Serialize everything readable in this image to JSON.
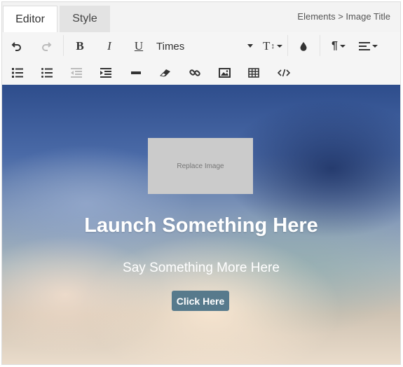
{
  "tabs": [
    {
      "label": "Editor",
      "active": true
    },
    {
      "label": "Style",
      "active": false
    }
  ],
  "breadcrumb": "Elements > Image Title",
  "toolbar": {
    "font_family": "Times",
    "bold_label": "B",
    "italic_label": "I",
    "underline_label": "U",
    "font_size_label": "T",
    "paragraph_label": "¶",
    "icons": [
      "undo-icon",
      "redo-icon",
      "bold-icon",
      "italic-icon",
      "underline-icon",
      "font-size-icon",
      "color-drop-icon",
      "paragraph-icon",
      "align-icon",
      "ordered-list-icon",
      "unordered-list-icon",
      "outdent-icon",
      "indent-icon",
      "horizontal-rule-icon",
      "eraser-icon",
      "link-icon",
      "image-icon",
      "table-icon",
      "code-icon"
    ]
  },
  "hero": {
    "image_placeholder": "Replace Image",
    "title": "Launch Something Here",
    "subtitle": "Say Something More Here",
    "button_label": "Click Here",
    "button_color": "#577a8c"
  }
}
